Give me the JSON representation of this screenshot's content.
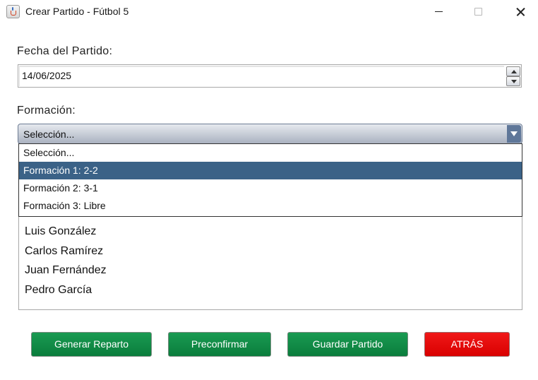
{
  "window": {
    "title": "Crear Partido - Fútbol 5"
  },
  "date": {
    "label": "Fecha del Partido:",
    "value": "14/06/2025"
  },
  "formation": {
    "label": "Formación:",
    "selected": "Selección...",
    "options": [
      "Selección...",
      "Formación 1: 2-2",
      "Formación 2: 3-1",
      "Formación 3: Libre"
    ],
    "highlighted_index": 1
  },
  "players": [
    "Luis González",
    "Carlos Ramírez",
    "Juan Fernández",
    "Pedro García"
  ],
  "buttons": {
    "generate": "Generar Reparto",
    "preconfirm": "Preconfirmar",
    "save": "Guardar Partido",
    "back": "ATRÁS"
  },
  "colors": {
    "green_button": "#0e8a45",
    "red_button": "#e60a0a",
    "selection_highlight": "#3b6287",
    "combo_arrow": "#5f7799"
  }
}
